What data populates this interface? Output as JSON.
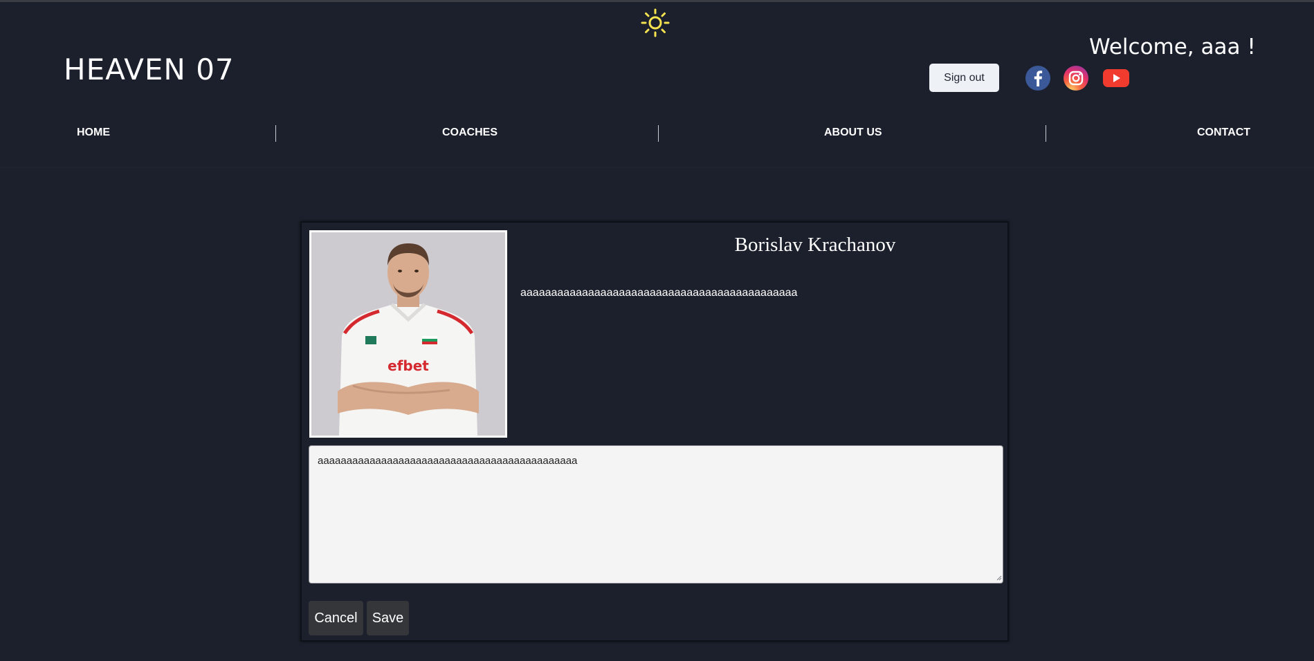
{
  "theme_toggle": {
    "icon": "sun-icon",
    "color": "#f5e44f"
  },
  "header": {
    "logo": "HEAVEN 07",
    "welcome": "Welcome, aaa !",
    "sign_out_label": "Sign out",
    "social": [
      {
        "icon": "facebook-icon",
        "color": "#3b5998"
      },
      {
        "icon": "instagram-icon",
        "color": "#e1306c"
      },
      {
        "icon": "youtube-icon",
        "color": "#f23b2f"
      }
    ]
  },
  "nav": {
    "items": [
      {
        "label": "HOME"
      },
      {
        "label": "COACHES"
      },
      {
        "label": "ABOUT US"
      },
      {
        "label": "CONTACT"
      }
    ]
  },
  "coach": {
    "name": "Borislav Krachanov",
    "description": "aaaaaaaaaaaaaaaaaaaaaaaaaaaaaaaaaaaaaaaaaaaaa",
    "photo_shirt_text": "efbet"
  },
  "editor": {
    "value": "aaaaaaaaaaaaaaaaaaaaaaaaaaaaaaaaaaaaaaaaaaaaa"
  },
  "actions": {
    "cancel_label": "Cancel",
    "save_label": "Save"
  }
}
